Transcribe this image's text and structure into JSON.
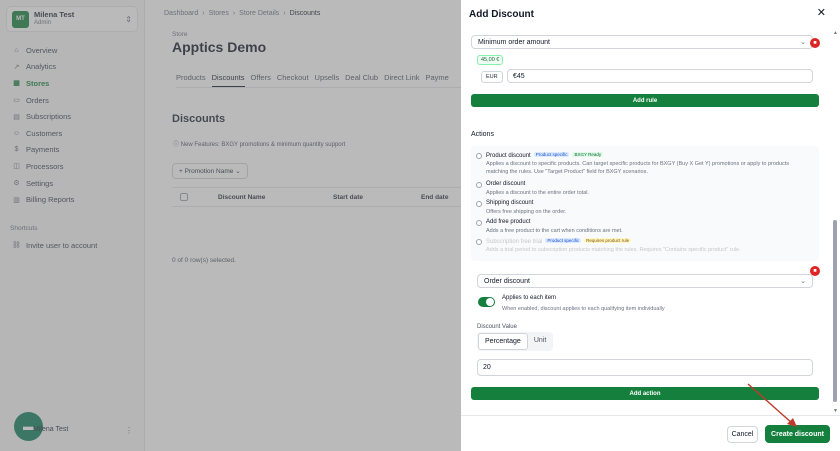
{
  "user": {
    "initials": "MT",
    "name": "Milena Test",
    "role": "Admin"
  },
  "sidebar": {
    "items": [
      {
        "label": "Overview",
        "icon": "home-icon"
      },
      {
        "label": "Analytics",
        "icon": "chart-icon"
      },
      {
        "label": "Stores",
        "icon": "store-icon"
      },
      {
        "label": "Orders",
        "icon": "orders-icon"
      },
      {
        "label": "Subscriptions",
        "icon": "subscriptions-icon"
      },
      {
        "label": "Customers",
        "icon": "customers-icon"
      },
      {
        "label": "Payments",
        "icon": "payments-icon"
      },
      {
        "label": "Processors",
        "icon": "processors-icon"
      },
      {
        "label": "Settings",
        "icon": "settings-icon"
      },
      {
        "label": "Billing Reports",
        "icon": "billing-icon"
      }
    ],
    "active_index": 2,
    "shortcuts_label": "Shortcuts",
    "shortcut_invite": "Invite user to account",
    "bottom_user": "Milena Test"
  },
  "breadcrumb": [
    "Dashboard",
    "Stores",
    "Store Details",
    "Discounts"
  ],
  "store": {
    "label": "Store",
    "title": "Apptics Demo"
  },
  "tabs": [
    "Products",
    "Discounts",
    "Offers",
    "Checkout",
    "Upsells",
    "Deal Club",
    "Direct Link",
    "Payme"
  ],
  "active_tab": 1,
  "discounts": {
    "title": "Discounts",
    "notice": "New Features: BXGY promotions & minimum quantity support",
    "promo_button": "Promotion Name",
    "columns": [
      "Discount Name",
      "Start date",
      "End date"
    ],
    "rows_selected": "0 of 0 row(s) selected."
  },
  "modal": {
    "title": "Add Discount",
    "rule": {
      "select_value": "Minimum order amount",
      "amount_pill": "45,00 €",
      "currency": "EUR",
      "amount_value": "€45",
      "add_rule": "Add rule"
    },
    "actions_label": "Actions",
    "options": [
      {
        "title": "Product discount",
        "tags": [
          "Product specific",
          "BXGY Ready"
        ],
        "desc": "Applies a discount to specific products. Can target specific products for BXGY (Buy X Get Y) promotions or apply to products matching the rules. Use \"Target Product\" field for BXGY scenarios."
      },
      {
        "title": "Order discount",
        "desc": "Applies a discount to the entire order total."
      },
      {
        "title": "Shipping discount",
        "desc": "Offers free shipping on the order."
      },
      {
        "title": "Add free product",
        "desc": "Adds a free product to the cart when conditions are met."
      },
      {
        "title": "Subscription free trial",
        "tags": [
          "Product specific",
          "Requires product rule"
        ],
        "desc": "Adds a trial period to subscription products matching the rules. Requires \"Contains specific product\" rule."
      }
    ],
    "action": {
      "select_value": "Order discount",
      "toggle_label": "Applies to each item",
      "toggle_on": true,
      "toggle_desc": "When enabled, discount applies to each qualifying item individually",
      "value_label": "Discount Value",
      "seg_percentage": "Percentage",
      "seg_unit": "Unit",
      "value": "20",
      "add_action": "Add action"
    },
    "cancel": "Cancel",
    "create": "Create discount"
  },
  "colors": {
    "accent": "#15803d",
    "danger": "#dc2626",
    "arrow": "#c0392b"
  }
}
